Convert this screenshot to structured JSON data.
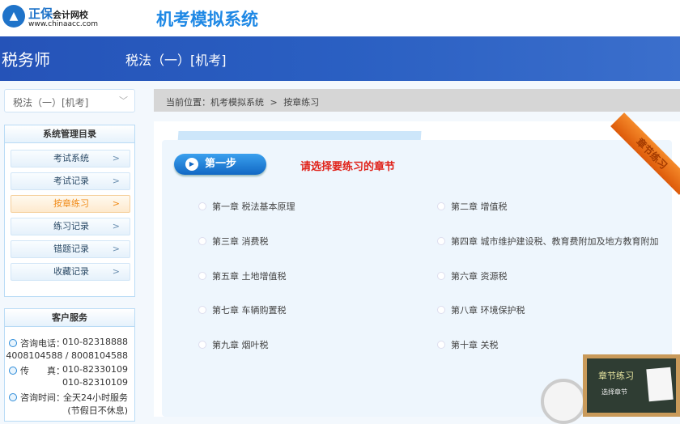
{
  "header": {
    "logo_brand": "正保",
    "logo_sub": "会计网校",
    "logo_url": "www.chinaacc.com",
    "title": "机考模拟系统"
  },
  "band": {
    "category": "税务师",
    "subject": "税法（一）[机考]"
  },
  "sidebar": {
    "select_value": "税法（一）[机考]",
    "menu_title": "系统管理目录",
    "menu": [
      {
        "label": "考试系统"
      },
      {
        "label": "考试记录"
      },
      {
        "label": "按章练习",
        "active": true
      },
      {
        "label": "练习记录"
      },
      {
        "label": "错题记录"
      },
      {
        "label": "收藏记录"
      }
    ],
    "service_title": "客户服务",
    "service": {
      "phone_label": "咨询电话：",
      "phone1": "010-82318888",
      "phone2": "4008104588 / 8008104588",
      "fax_label": "传　　真：",
      "fax1": "010-82330109",
      "fax2": "010-82310109",
      "time_label": "咨询时间：",
      "time": "全天24小时服务",
      "time_note": "(节假日不休息)"
    }
  },
  "breadcrumb": {
    "prefix": "当前位置：",
    "items": [
      "机考模拟系统",
      "按章练习"
    ],
    "sep": ">"
  },
  "main": {
    "step_label": "第一步",
    "hint": "请选择要练习的章节",
    "ribbon": "章节练习",
    "board_title": "章节练习",
    "board_sub": "选择章节",
    "chapters": [
      "第一章 税法基本原理",
      "第二章 增值税",
      "第三章 消费税",
      "第四章 城市维护建设税、教育费附加及地方教育附加",
      "第五章 土地增值税",
      "第六章 资源税",
      "第七章 车辆购置税",
      "第八章 环境保护税",
      "第九章 烟叶税",
      "第十章 关税"
    ]
  }
}
